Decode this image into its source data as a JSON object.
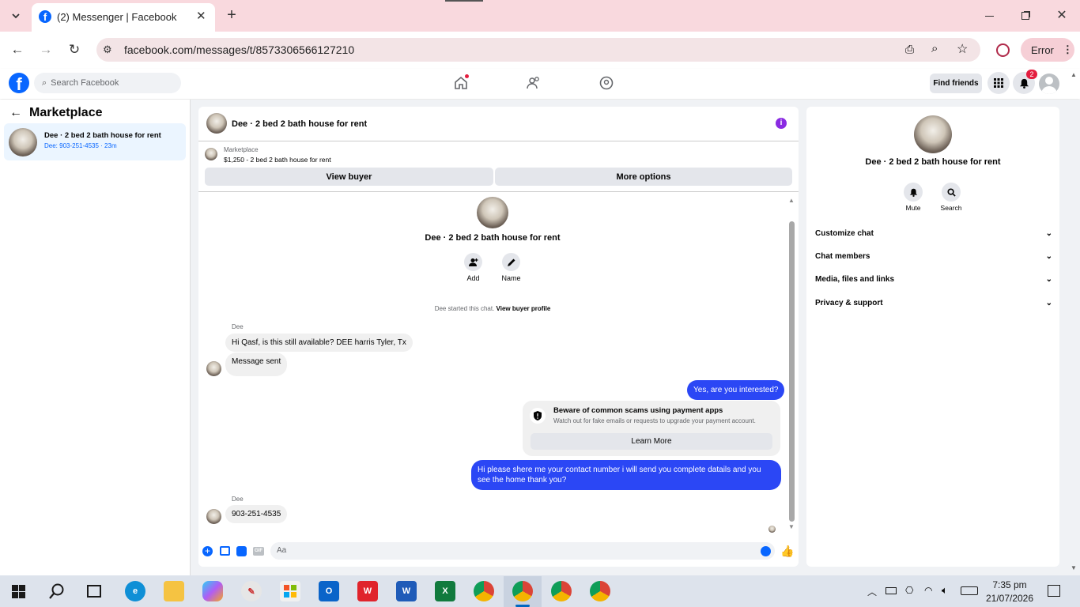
{
  "browser": {
    "tab_title": "(2) Messenger | Facebook",
    "url": "facebook.com/messages/t/8573306566127210",
    "profile_status": "Error"
  },
  "fb": {
    "search_placeholder": "Search Facebook",
    "find_friends": "Find friends",
    "notification_count": "2"
  },
  "left": {
    "title": "Marketplace",
    "conversations": [
      {
        "name": "Dee · 2 bed 2 bath house for rent",
        "preview": "Dee: 903-251-4535 · 23m"
      }
    ]
  },
  "chat": {
    "title": "Dee · 2 bed 2 bath house for rent",
    "listing_source": "Marketplace",
    "listing": "$1,250 - 2 bed 2 bath house for rent",
    "view_buyer": "View buyer",
    "more_options": "More options",
    "intro_name": "Dee · 2 bed 2 bath house for rent",
    "add_label": "Add",
    "name_label": "Name",
    "started_text": "Dee started this chat.",
    "view_buyer_profile": "View buyer profile",
    "sender1": "Dee",
    "msg1": "Hi Qasf, is this still available? DEE harris  Tyler, Tx",
    "msg2": "Message sent",
    "reply1": "Yes, are you interested?",
    "warning_title": "Beware of common scams using payment apps",
    "warning_body": "Watch out for fake emails or requests to upgrade your payment account.",
    "learn_more": "Learn More",
    "reply2": "Hi please shere me your contact number i will send you complete datails and you see the home thank you?",
    "sender2": "Dee",
    "msg3": "903-251-4535",
    "composer_placeholder": "Aa"
  },
  "info": {
    "name": "Dee · 2 bed 2 bath house for rent",
    "mute": "Mute",
    "search": "Search",
    "sections": [
      "Customize chat",
      "Chat members",
      "Media, files and links",
      "Privacy & support"
    ]
  },
  "taskbar": {
    "time": "7:35 pm",
    "date": "21/07/2026"
  },
  "colors": {
    "messenger_blue": "#2b47f5",
    "fb_blue": "#0866ff",
    "tabbar": "#f9d9de"
  }
}
